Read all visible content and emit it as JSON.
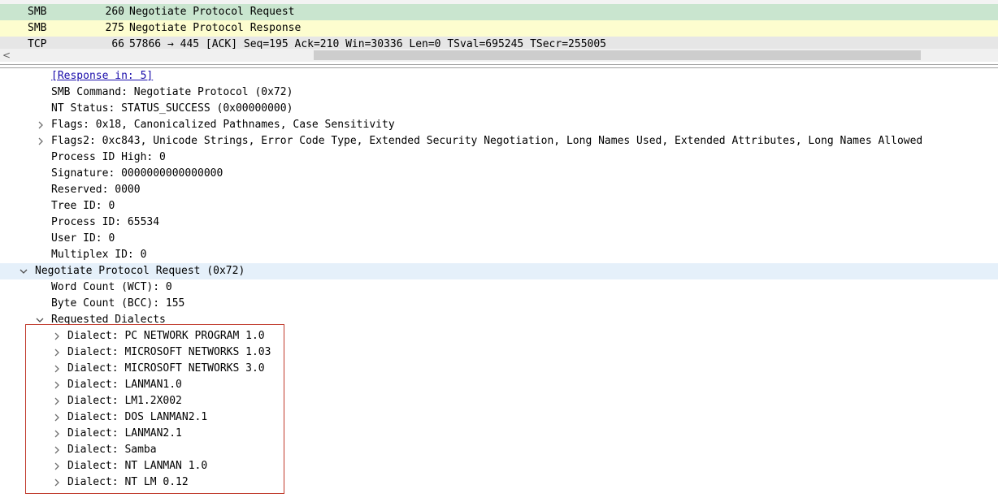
{
  "packet_list": {
    "rows": [
      {
        "protocol": "SMB",
        "length": "260",
        "info": "Negotiate Protocol Request"
      },
      {
        "protocol": "SMB",
        "length": "275",
        "info": "Negotiate Protocol Response"
      },
      {
        "protocol": "TCP",
        "length": "66",
        "info": "57866 → 445 [ACK] Seq=195 Ack=210 Win=30336 Len=0 TSval=695245 TSecr=255005"
      }
    ]
  },
  "scrollbar": {
    "left_arrow": "<"
  },
  "details": {
    "response_link": "[Response in: 5]",
    "smb_command": "SMB Command: Negotiate Protocol (0x72)",
    "nt_status": "NT Status: STATUS_SUCCESS (0x00000000)",
    "flags": "Flags: 0x18, Canonicalized Pathnames, Case Sensitivity",
    "flags2": "Flags2: 0xc843, Unicode Strings, Error Code Type, Extended Security Negotiation, Long Names Used, Extended Attributes, Long Names Allowed",
    "pid_high": "Process ID High: 0",
    "signature": "Signature: 0000000000000000",
    "reserved": "Reserved: 0000",
    "tree_id": "Tree ID: 0",
    "process_id": "Process ID: 65534",
    "user_id": "User ID: 0",
    "multiplex_id": "Multiplex ID: 0",
    "negotiate_request": "Negotiate Protocol Request (0x72)",
    "word_count": "Word Count (WCT): 0",
    "byte_count": "Byte Count (BCC): 155",
    "requested_dialects": "Requested Dialects",
    "dialects": [
      "Dialect: PC NETWORK PROGRAM 1.0",
      "Dialect: MICROSOFT NETWORKS 1.03",
      "Dialect: MICROSOFT NETWORKS 3.0",
      "Dialect: LANMAN1.0",
      "Dialect: LM1.2X002",
      "Dialect: DOS LANMAN2.1",
      "Dialect: LANMAN2.1",
      "Dialect: Samba",
      "Dialect: NT LANMAN 1.0",
      "Dialect: NT LM 0.12"
    ]
  },
  "colors": {
    "smb_row": "#c9e5cf",
    "smb_response_row": "#fdfdcf",
    "tcp_row": "#e6e6e6",
    "selected_row": "#e5f0fa",
    "highlight_border": "#c0392b",
    "link": "#1a0dab"
  }
}
